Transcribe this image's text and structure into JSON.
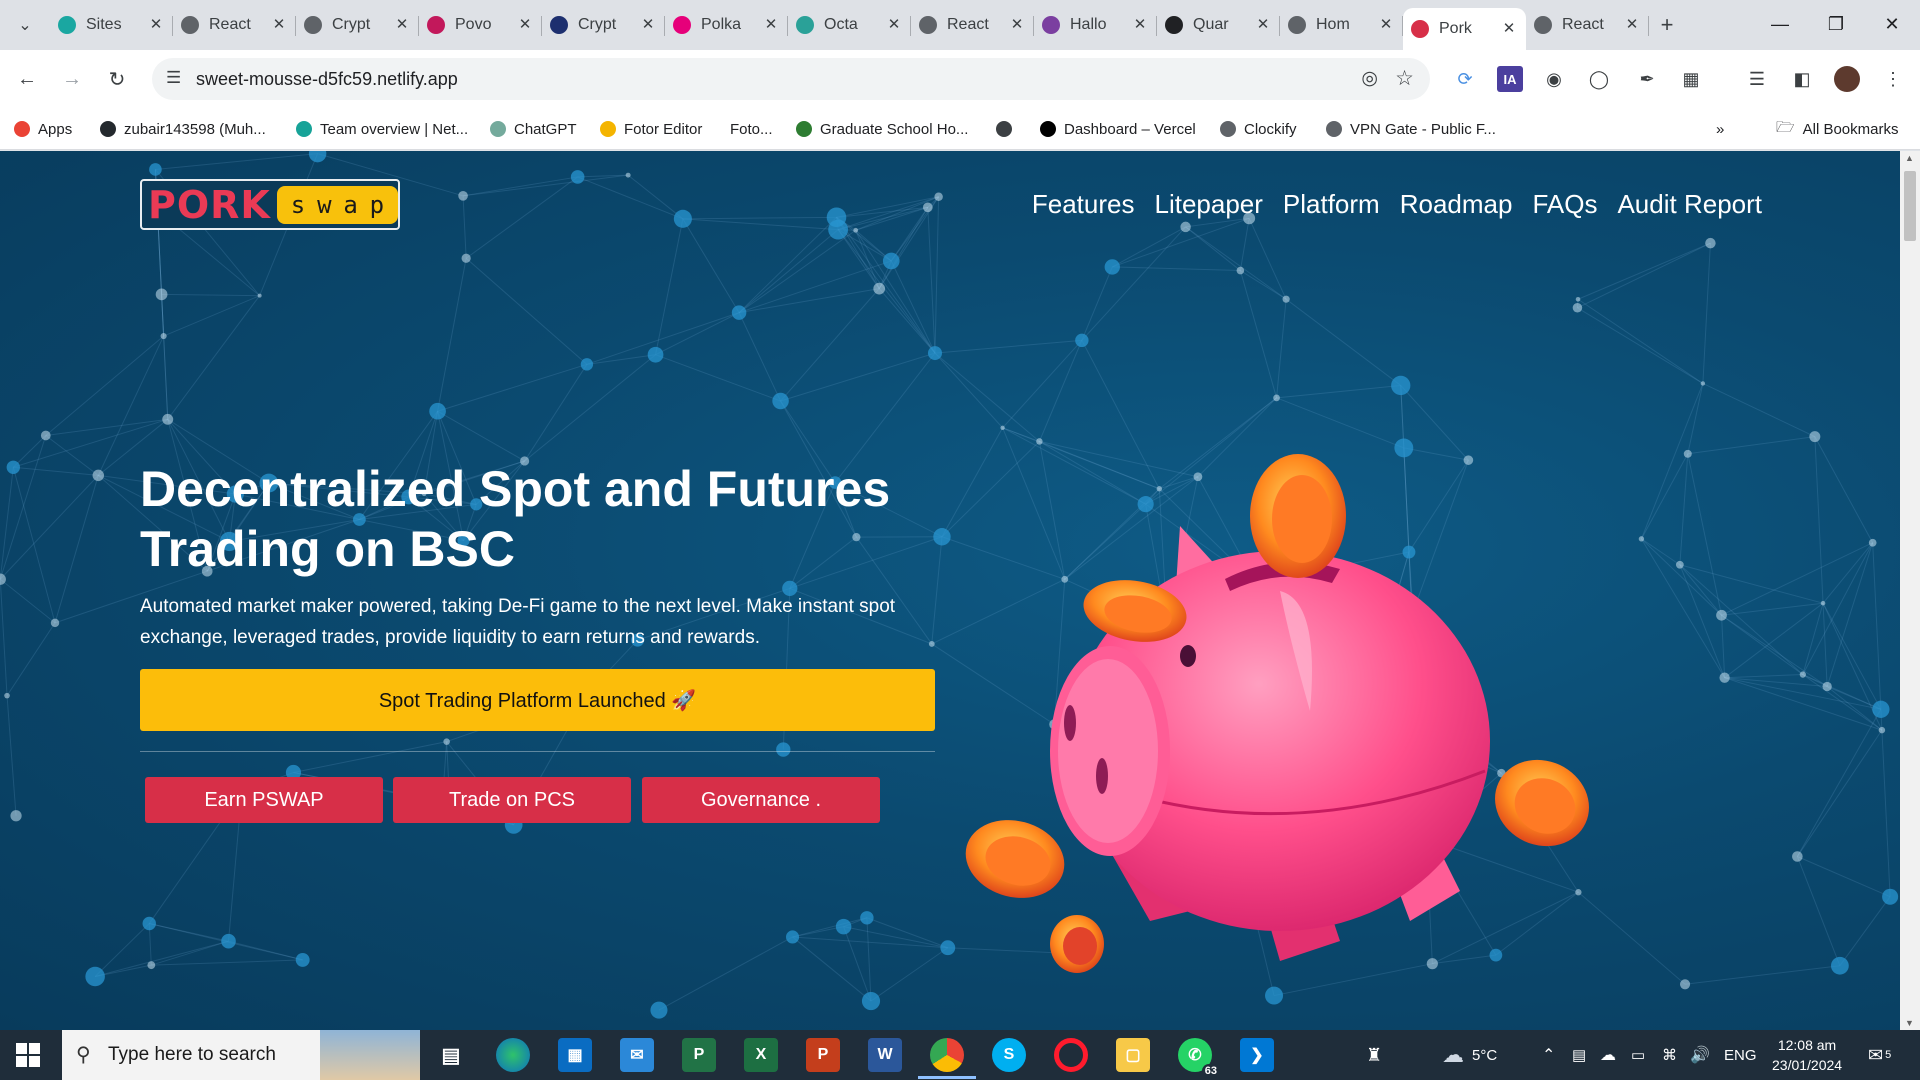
{
  "browser": {
    "tabs": [
      {
        "label": "Sites",
        "color": "#1aa7a1"
      },
      {
        "label": "React",
        "color": "#5f6368"
      },
      {
        "label": "Crypt",
        "color": "#5f6368"
      },
      {
        "label": "Povo",
        "color": "#c2185b"
      },
      {
        "label": "Crypt",
        "color": "#1d2f6f"
      },
      {
        "label": "Polka",
        "color": "#e6007a"
      },
      {
        "label": "Octa",
        "color": "#2aa198"
      },
      {
        "label": "React",
        "color": "#5f6368"
      },
      {
        "label": "Hallo",
        "color": "#7b3fa0"
      },
      {
        "label": "Quar",
        "color": "#202124"
      },
      {
        "label": "Hom",
        "color": "#5f6368"
      },
      {
        "label": "Pork",
        "color": "#d72f48",
        "active": true
      },
      {
        "label": "React",
        "color": "#5f6368"
      }
    ],
    "url": "sweet-mousse-d5fc59.netlify.app",
    "bookmarks": [
      {
        "label": "Apps",
        "color": "#ea4335"
      },
      {
        "label": "zubair143598 (Muh...",
        "color": "#24292e"
      },
      {
        "label": "Team overview | Net...",
        "color": "#17a398"
      },
      {
        "label": "ChatGPT",
        "color": "#74aa9c"
      },
      {
        "label": "Fotor Editor",
        "color": "#f4b400"
      },
      {
        "label": "Foto...",
        "color": "#ffffff"
      },
      {
        "label": "Graduate School Ho...",
        "color": "#2e7d32"
      },
      {
        "label": "",
        "color": "#3c4043"
      },
      {
        "label": "Dashboard – Vercel",
        "color": "#000000"
      },
      {
        "label": "Clockify",
        "color": "#5f6368"
      },
      {
        "label": "VPN Gate - Public F...",
        "color": "#5f6368"
      }
    ],
    "all_bookmarks": "All Bookmarks"
  },
  "site": {
    "logo": {
      "pork": "PORK",
      "swap": [
        "s",
        "w",
        "a",
        "p"
      ]
    },
    "nav": [
      "Features",
      "Litepaper",
      "Platform",
      "Roadmap",
      "FAQs",
      "Audit Report"
    ],
    "hero": {
      "title": "Decentralized Spot and Futures Trading on BSC",
      "description": "Automated market maker powered, taking De-Fi game to the next level. Make instant spot exchange, leveraged trades, provide liquidity to earn returns and rewards.",
      "cta": "Spot Trading Platform Launched 🚀",
      "buttons": [
        "Earn PSWAP",
        "Trade on PCS",
        "Governance ."
      ]
    },
    "colors": {
      "background": "#0b4a70",
      "accent_yellow": "#fcbd0a",
      "accent_red": "#d72f48",
      "pig_pink": "#ff4f8b",
      "coin_orange": "#ff8a1f"
    }
  },
  "taskbar": {
    "search_placeholder": "Type here to search",
    "whatsapp_badge": "63",
    "weather": "5°C",
    "language": "ENG",
    "time": "12:08 am",
    "date": "23/01/2024",
    "notifications": "5"
  }
}
